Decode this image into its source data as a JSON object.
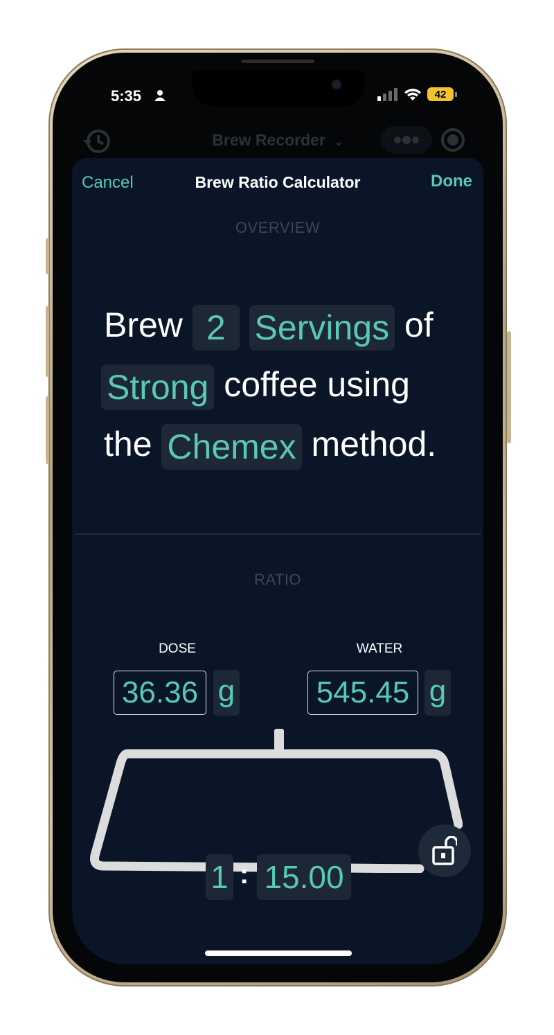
{
  "status_bar": {
    "time": "5:35",
    "battery": "42",
    "icons": [
      "person-icon",
      "cellular-signal-icon",
      "wifi-icon",
      "battery-icon"
    ]
  },
  "background_nav": {
    "title": "Brew Recorder",
    "icons": [
      "history-icon",
      "chevron-down-icon",
      "more-icon",
      "record-icon"
    ]
  },
  "nav": {
    "cancel_label": "Cancel",
    "title": "Brew Ratio Calculator",
    "done_label": "Done"
  },
  "overview": {
    "label": "OVERVIEW",
    "word_brew": "Brew",
    "servings_count": "2",
    "servings_unit": "Servings",
    "word_of": "of",
    "strength": "Strong",
    "word_coffee_using": "coffee using",
    "word_the": "the",
    "method": "Chemex",
    "word_method": "method."
  },
  "ratio": {
    "label": "RATIO",
    "dose_label": "DOSE",
    "dose_value": "36.36",
    "dose_unit": "g",
    "water_label": "WATER",
    "water_value": "545.45",
    "water_unit": "g",
    "ratio_left": "1",
    "ratio_separator": ":",
    "ratio_right": "15.00"
  },
  "colors": {
    "accent": "#58c9b2",
    "sheet_background": "#0a1628",
    "chip_background": "#1d2736"
  }
}
